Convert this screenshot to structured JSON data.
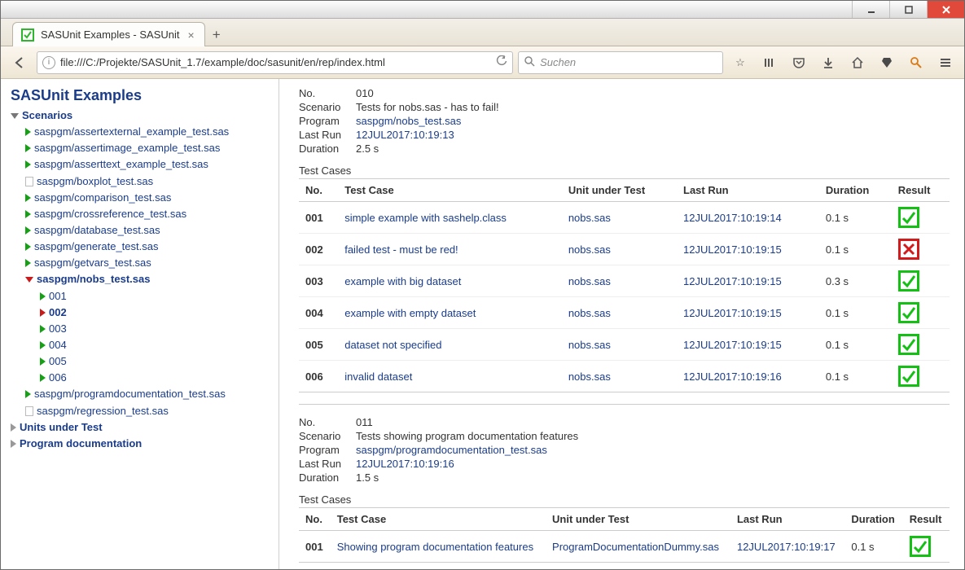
{
  "window": {
    "tab_title": "SASUnit Examples - SASUnit"
  },
  "addressbar": {
    "url": "file:///C:/Projekte/SASUnit_1.7/example/doc/sasunit/en/rep/index.html",
    "search_placeholder": "Suchen"
  },
  "sidebar": {
    "title": "SASUnit Examples",
    "scenarios_label": "Scenarios",
    "units_label": "Units under Test",
    "progdoc_label": "Program documentation",
    "items": [
      {
        "label": "saspgm/assertexternal_example_test.sas",
        "icon": "green"
      },
      {
        "label": "saspgm/assertimage_example_test.sas",
        "icon": "green"
      },
      {
        "label": "saspgm/asserttext_example_test.sas",
        "icon": "green"
      },
      {
        "label": "saspgm/boxplot_test.sas",
        "icon": "doc",
        "plain": true
      },
      {
        "label": "saspgm/comparison_test.sas",
        "icon": "green"
      },
      {
        "label": "saspgm/crossreference_test.sas",
        "icon": "green"
      },
      {
        "label": "saspgm/database_test.sas",
        "icon": "green"
      },
      {
        "label": "saspgm/generate_test.sas",
        "icon": "green"
      },
      {
        "label": "saspgm/getvars_test.sas",
        "icon": "green"
      },
      {
        "label": "saspgm/nobs_test.sas",
        "icon": "red-open",
        "bold": true,
        "children": [
          {
            "label": "001",
            "icon": "green"
          },
          {
            "label": "002",
            "icon": "red",
            "bold": true
          },
          {
            "label": "003",
            "icon": "green"
          },
          {
            "label": "004",
            "icon": "green"
          },
          {
            "label": "005",
            "icon": "green"
          },
          {
            "label": "006",
            "icon": "green"
          }
        ]
      },
      {
        "label": "saspgm/programdocumentation_test.sas",
        "icon": "green"
      },
      {
        "label": "saspgm/regression_test.sas",
        "icon": "doc",
        "plain": true
      }
    ]
  },
  "sections": [
    {
      "meta": [
        {
          "k": "No.",
          "v": "010"
        },
        {
          "k": "Scenario",
          "v": "Tests for nobs.sas - has to fail!"
        },
        {
          "k": "Program",
          "v": "saspgm/nobs_test.sas",
          "link": true
        },
        {
          "k": "Last Run",
          "v": "12JUL2017:10:19:13",
          "link": true
        },
        {
          "k": "Duration",
          "v": "2.5 s"
        }
      ],
      "testcases_label": "Test Cases",
      "columns": [
        "No.",
        "Test Case",
        "Unit under Test",
        "Last Run",
        "Duration",
        "Result"
      ],
      "rows": [
        {
          "n": "001",
          "c": "simple example with sashelp.class",
          "u": "nobs.sas",
          "r": "12JUL2017:10:19:14",
          "d": "0.1 s",
          "ok": true
        },
        {
          "n": "002",
          "c": "failed test - must be red!",
          "u": "nobs.sas",
          "r": "12JUL2017:10:19:15",
          "d": "0.1 s",
          "ok": false
        },
        {
          "n": "003",
          "c": "example with big dataset",
          "u": "nobs.sas",
          "r": "12JUL2017:10:19:15",
          "d": "0.3 s",
          "ok": true
        },
        {
          "n": "004",
          "c": "example with empty dataset",
          "u": "nobs.sas",
          "r": "12JUL2017:10:19:15",
          "d": "0.1 s",
          "ok": true
        },
        {
          "n": "005",
          "c": "dataset not specified",
          "u": "nobs.sas",
          "r": "12JUL2017:10:19:15",
          "d": "0.1 s",
          "ok": true
        },
        {
          "n": "006",
          "c": "invalid dataset",
          "u": "nobs.sas",
          "r": "12JUL2017:10:19:16",
          "d": "0.1 s",
          "ok": true
        }
      ]
    },
    {
      "meta": [
        {
          "k": "No.",
          "v": "011"
        },
        {
          "k": "Scenario",
          "v": "Tests showing program documentation features"
        },
        {
          "k": "Program",
          "v": "saspgm/programdocumentation_test.sas",
          "link": true
        },
        {
          "k": "Last Run",
          "v": "12JUL2017:10:19:16",
          "link": true
        },
        {
          "k": "Duration",
          "v": "1.5 s"
        }
      ],
      "testcases_label": "Test Cases",
      "columns": [
        "No.",
        "Test Case",
        "Unit under Test",
        "Last Run",
        "Duration",
        "Result"
      ],
      "rows": [
        {
          "n": "001",
          "c": "Showing program documentation features",
          "u": "ProgramDocumentationDummy.sas",
          "r": "12JUL2017:10:19:17",
          "d": "0.1 s",
          "ok": true
        }
      ]
    }
  ]
}
